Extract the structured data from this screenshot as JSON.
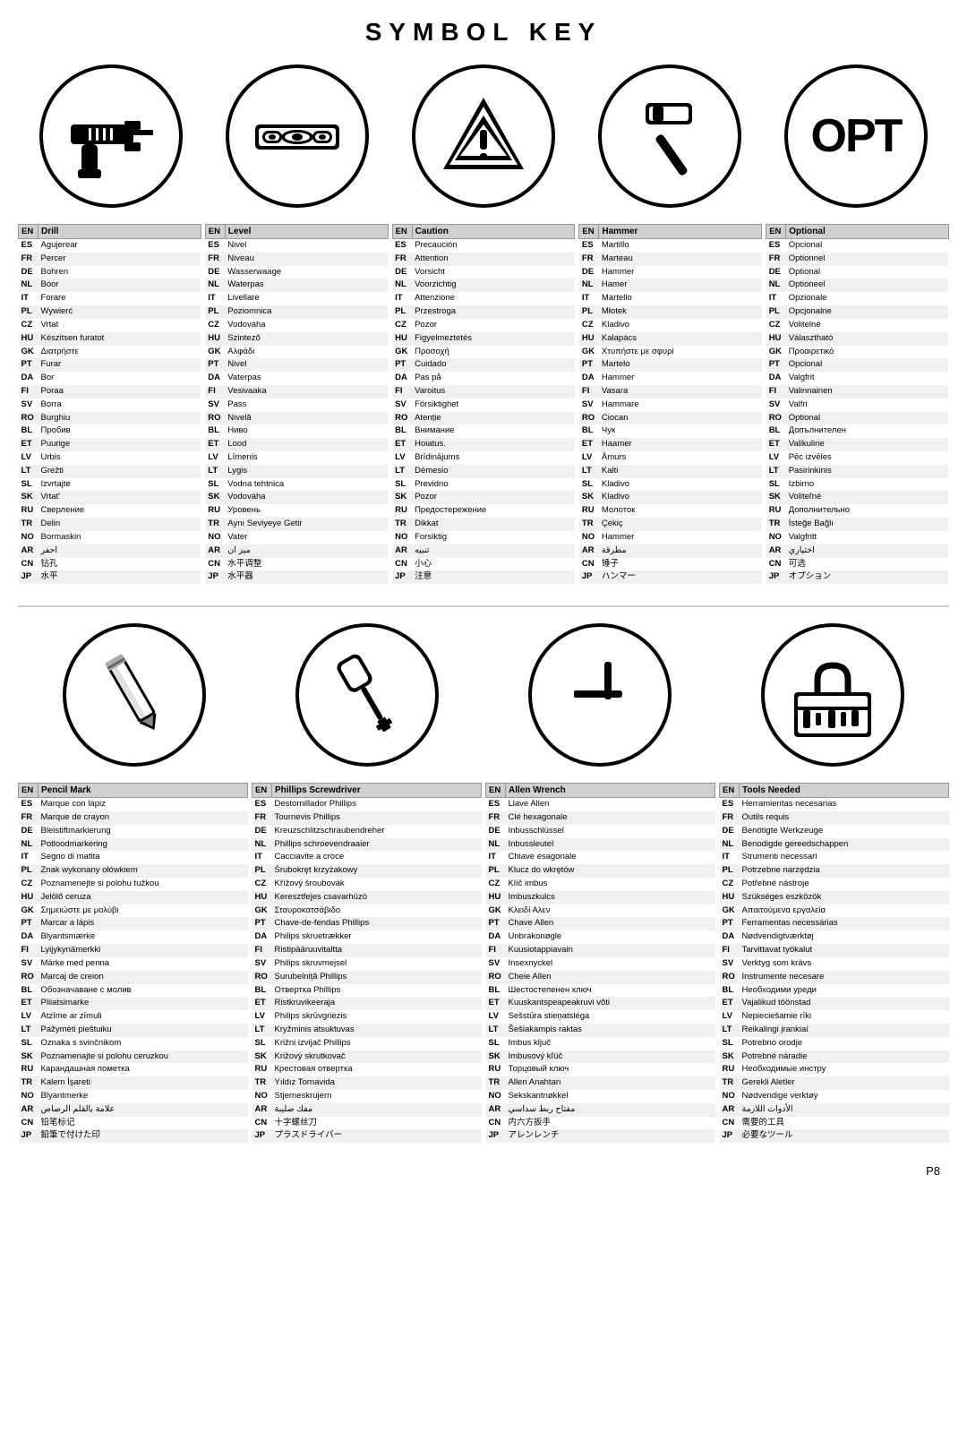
{
  "title": "SYMBOL KEY",
  "page_number": "P8",
  "icons_row1": [
    {
      "id": "drill",
      "type": "svg_drill"
    },
    {
      "id": "level",
      "type": "svg_level"
    },
    {
      "id": "caution",
      "type": "svg_caution"
    },
    {
      "id": "hammer",
      "type": "svg_hammer"
    },
    {
      "id": "optional",
      "type": "text_opt",
      "text": "OPT"
    }
  ],
  "icons_row2": [
    {
      "id": "pencil",
      "type": "svg_pencil"
    },
    {
      "id": "phillips",
      "type": "svg_phillips"
    },
    {
      "id": "allen",
      "type": "svg_allen"
    },
    {
      "id": "toolbox",
      "type": "svg_toolbox"
    }
  ],
  "tables": [
    {
      "id": "drill_table",
      "header_en": "EN",
      "header_term": "Drill",
      "rows": [
        [
          "ES",
          "Agujerear"
        ],
        [
          "FR",
          "Percer"
        ],
        [
          "DE",
          "Bohren"
        ],
        [
          "NL",
          "Boor"
        ],
        [
          "IT",
          "Forare"
        ],
        [
          "PL",
          "Wywierć"
        ],
        [
          "CZ",
          "Vrtat"
        ],
        [
          "HU",
          "Készitsen furatot"
        ],
        [
          "GK",
          "Διατρήστε"
        ],
        [
          "PT",
          "Furar"
        ],
        [
          "DA",
          "Bor"
        ],
        [
          "FI",
          "Poraa"
        ],
        [
          "SV",
          "Borra"
        ],
        [
          "RO",
          "Burghiu"
        ],
        [
          "BL",
          "Пробив"
        ],
        [
          "ET",
          "Puurige"
        ],
        [
          "LV",
          "Urbis"
        ],
        [
          "LT",
          "Grežti"
        ],
        [
          "SL",
          "Izvrtajte"
        ],
        [
          "SK",
          "Vrtat'"
        ],
        [
          "RU",
          "Сверление"
        ],
        [
          "TR",
          "Delin"
        ],
        [
          "NO",
          "Bormaskin"
        ],
        [
          "AR",
          "احفر"
        ],
        [
          "CN",
          "钻孔"
        ],
        [
          "JP",
          "水平"
        ]
      ]
    },
    {
      "id": "level_table",
      "header_en": "EN",
      "header_term": "Level",
      "rows": [
        [
          "ES",
          "Nivel"
        ],
        [
          "FR",
          "Niveau"
        ],
        [
          "DE",
          "Wasserwaage"
        ],
        [
          "NL",
          "Waterpas"
        ],
        [
          "IT",
          "Livellare"
        ],
        [
          "PL",
          "Poziomnica"
        ],
        [
          "CZ",
          "Vodováha"
        ],
        [
          "HU",
          "Szintező"
        ],
        [
          "GK",
          "Αλφάδι"
        ],
        [
          "PT",
          "Nivel"
        ],
        [
          "DA",
          "Vaterpas"
        ],
        [
          "FI",
          "Vesivaaka"
        ],
        [
          "SV",
          "Pass"
        ],
        [
          "RO",
          "Nivelă"
        ],
        [
          "BL",
          "Ниво"
        ],
        [
          "ET",
          "Lood"
        ],
        [
          "LV",
          "Līmenis"
        ],
        [
          "LT",
          "Lygis"
        ],
        [
          "SL",
          "Vodna tehtnica"
        ],
        [
          "SK",
          "Vodováha"
        ],
        [
          "RU",
          "Уровень"
        ],
        [
          "TR",
          "Aynı Seviyeye Getir"
        ],
        [
          "NO",
          "Vater"
        ],
        [
          "AR",
          "ميز ان"
        ],
        [
          "CN",
          "水平调整"
        ],
        [
          "JP",
          "水平器"
        ]
      ]
    },
    {
      "id": "caution_table",
      "header_en": "EN",
      "header_term": "Caution",
      "rows": [
        [
          "ES",
          "Precaución"
        ],
        [
          "FR",
          "Attention"
        ],
        [
          "DE",
          "Vorsicht"
        ],
        [
          "NL",
          "Voorzichtig"
        ],
        [
          "IT",
          "Attenzione"
        ],
        [
          "PL",
          "Przestroga"
        ],
        [
          "CZ",
          "Pozor"
        ],
        [
          "HU",
          "Figyelmeztetés"
        ],
        [
          "GK",
          "Προσοχή"
        ],
        [
          "PT",
          "Cuidado"
        ],
        [
          "DA",
          "Pas på"
        ],
        [
          "FI",
          "Varoitus"
        ],
        [
          "SV",
          "Försiktighet"
        ],
        [
          "RO",
          "Atenție"
        ],
        [
          "BL",
          "Внимание"
        ],
        [
          "ET",
          "Hoiatus."
        ],
        [
          "LV",
          "Brīdinājums"
        ],
        [
          "LT",
          "Dėmesio"
        ],
        [
          "SL",
          "Previdno"
        ],
        [
          "SK",
          "Pozor"
        ],
        [
          "RU",
          "Предостережение"
        ],
        [
          "TR",
          "Dikkat"
        ],
        [
          "NO",
          "Forsiktig"
        ],
        [
          "AR",
          "تنبيه"
        ],
        [
          "CN",
          "小心"
        ],
        [
          "JP",
          "注意"
        ]
      ]
    },
    {
      "id": "hammer_table",
      "header_en": "EN",
      "header_term": "Hammer",
      "rows": [
        [
          "ES",
          "Martillo"
        ],
        [
          "FR",
          "Marteau"
        ],
        [
          "DE",
          "Hammer"
        ],
        [
          "NL",
          "Hamer"
        ],
        [
          "IT",
          "Martello"
        ],
        [
          "PL",
          "Młotek"
        ],
        [
          "CZ",
          "Kladivo"
        ],
        [
          "HU",
          "Kalapács"
        ],
        [
          "GK",
          "Χτυπήστε με σφυρί"
        ],
        [
          "PT",
          "Martelo"
        ],
        [
          "DA",
          "Hammer"
        ],
        [
          "FI",
          "Vasara"
        ],
        [
          "SV",
          "Hammare"
        ],
        [
          "RO",
          "Ciocan"
        ],
        [
          "BL",
          "Чук"
        ],
        [
          "ET",
          "Haamer"
        ],
        [
          "LV",
          "Āmurs"
        ],
        [
          "LT",
          "Kalti"
        ],
        [
          "SL",
          "Kladivo"
        ],
        [
          "SK",
          "Kladivo"
        ],
        [
          "RU",
          "Молоток"
        ],
        [
          "TR",
          "Çekiç"
        ],
        [
          "NO",
          "Hammer"
        ],
        [
          "AR",
          "مطرقة"
        ],
        [
          "CN",
          "锤子"
        ],
        [
          "JP",
          "ハンマー"
        ]
      ]
    },
    {
      "id": "optional_table",
      "header_en": "EN",
      "header_term": "Optional",
      "rows": [
        [
          "ES",
          "Opcional"
        ],
        [
          "FR",
          "Optionnel"
        ],
        [
          "DE",
          "Optional"
        ],
        [
          "NL",
          "Optioneel"
        ],
        [
          "IT",
          "Opzionale"
        ],
        [
          "PL",
          "Opcjonalne"
        ],
        [
          "CZ",
          "Volitelné"
        ],
        [
          "HU",
          "Választható"
        ],
        [
          "GK",
          "Προαιρετικό"
        ],
        [
          "PT",
          "Opcional"
        ],
        [
          "DA",
          "Valgfrit"
        ],
        [
          "FI",
          "Valinnainen"
        ],
        [
          "SV",
          "Valfri"
        ],
        [
          "RO",
          "Optional"
        ],
        [
          "BL",
          "Допълнителен"
        ],
        [
          "ET",
          "Valikuline"
        ],
        [
          "LV",
          "Pēc izvēles"
        ],
        [
          "LT",
          "Pasirinkinis"
        ],
        [
          "SL",
          "Izbirno"
        ],
        [
          "SK",
          "Voliteľné"
        ],
        [
          "RU",
          "Дополнительно"
        ],
        [
          "TR",
          "İsteğe Bağlı"
        ],
        [
          "NO",
          "Valgfritt"
        ],
        [
          "AR",
          "اختياري"
        ],
        [
          "CN",
          "可选"
        ],
        [
          "JP",
          "オプション"
        ]
      ]
    }
  ],
  "tables2": [
    {
      "id": "pencil_table",
      "header_en": "EN",
      "header_term": "Pencil Mark",
      "rows": [
        [
          "ES",
          "Marque con lápiz"
        ],
        [
          "FR",
          "Marque de crayon"
        ],
        [
          "DE",
          "Bleistiftmarkierung"
        ],
        [
          "NL",
          "Potloodmarkering"
        ],
        [
          "IT",
          "Segno di matita"
        ],
        [
          "PL",
          "Znak wykonany ołówkiem"
        ],
        [
          "CZ",
          "Poznamenejte si polohu tužkou"
        ],
        [
          "HU",
          "Jelölő ceruza"
        ],
        [
          "GK",
          "Σημειώστε με μολύβι"
        ],
        [
          "PT",
          "Marcar a lápis"
        ],
        [
          "DA",
          "Blyantsmærke"
        ],
        [
          "FI",
          "Lyijykynämerkki"
        ],
        [
          "SV",
          "Märke med penna"
        ],
        [
          "RO",
          "Marcaj de creion"
        ],
        [
          "BL",
          "Обозначаване с молив"
        ],
        [
          "ET",
          "Pliiatsimarke"
        ],
        [
          "LV",
          "Atzīme ar zīmuli"
        ],
        [
          "LT",
          "Pažymėti pieštuiku"
        ],
        [
          "SL",
          "Oznaka s svinčnikom"
        ],
        [
          "SK",
          "Poznamenajte si polohu ceruzkou"
        ],
        [
          "RU",
          "Карандашная пометка"
        ],
        [
          "TR",
          "Kalem İşareti"
        ],
        [
          "NO",
          "Blyantmerke"
        ],
        [
          "AR",
          "علامة بالقلم الرصاص"
        ],
        [
          "CN",
          "铅笔标记"
        ],
        [
          "JP",
          "鉛筆で付けた印"
        ]
      ]
    },
    {
      "id": "phillips_table",
      "header_en": "EN",
      "header_term": "Phillips Screwdriver",
      "rows": [
        [
          "ES",
          "Destornillador Phillips"
        ],
        [
          "FR",
          "Tournevis Phillips"
        ],
        [
          "DE",
          "Kreuzschlitzschraubendreher"
        ],
        [
          "NL",
          "Phillips schroevendraaier"
        ],
        [
          "IT",
          "Cacciavite a croce"
        ],
        [
          "PL",
          "Śrubokręt krzyżakowy"
        ],
        [
          "CZ",
          "Křížový šroubovák"
        ],
        [
          "HU",
          "Keresztfejes csavarhúzó"
        ],
        [
          "GK",
          "Σταυροκατσάβιδο"
        ],
        [
          "PT",
          "Chave-de-fendas Phillips"
        ],
        [
          "DA",
          "Philips skruetrækker"
        ],
        [
          "FI",
          "Ristipääruuvitaltta"
        ],
        [
          "SV",
          "Philips skruvmejsel"
        ],
        [
          "RO",
          "Șurubelniță Phillips"
        ],
        [
          "BL",
          "Отвертка Phillips"
        ],
        [
          "ET",
          "Ristkruvikeeraja"
        ],
        [
          "LV",
          "Philips skrūvgriezis"
        ],
        [
          "LT",
          "Kryžminis atsuktuvas"
        ],
        [
          "SL",
          "Križni izvijač Phillips"
        ],
        [
          "SK",
          "Križový skrutkovač"
        ],
        [
          "RU",
          "Крестовая отвертка"
        ],
        [
          "TR",
          "Yıldız Tornavida"
        ],
        [
          "NO",
          "Stjerneskrujern"
        ],
        [
          "AR",
          "مفك صليبة"
        ],
        [
          "CN",
          "十字螺丝刀"
        ],
        [
          "JP",
          "プラスドライバー"
        ]
      ]
    },
    {
      "id": "allen_table",
      "header_en": "EN",
      "header_term": "Allen Wrench",
      "rows": [
        [
          "ES",
          "Llave Allen"
        ],
        [
          "FR",
          "Clé hexagonale"
        ],
        [
          "DE",
          "Inbusschlüssel"
        ],
        [
          "NL",
          "Inbussleutel"
        ],
        [
          "IT",
          "Chiave esagonale"
        ],
        [
          "PL",
          "Klucz do wkrętów"
        ],
        [
          "CZ",
          "Klíč imbus"
        ],
        [
          "HU",
          "Imbuszkulcs"
        ],
        [
          "GK",
          "Κλειδί Αλεν"
        ],
        [
          "PT",
          "Chave Allen"
        ],
        [
          "DA",
          "Unbrakonøgle"
        ],
        [
          "FI",
          "Kuusiotappiavain"
        ],
        [
          "SV",
          "Insexnyckel"
        ],
        [
          "RO",
          "Cheie Allen"
        ],
        [
          "BL",
          "Шестостепенен ключ"
        ],
        [
          "ET",
          "Kuuskantspeapeakruvi võti"
        ],
        [
          "LV",
          "Sešstūra stieņatsléga"
        ],
        [
          "LT",
          "Šešiakampis raktas"
        ],
        [
          "SL",
          "Imbus ključ"
        ],
        [
          "SK",
          "Imbusový kľúč"
        ],
        [
          "RU",
          "Торцовый ключ"
        ],
        [
          "TR",
          "Allen Anahtarı"
        ],
        [
          "NO",
          "Sekskantnøkkel"
        ],
        [
          "AR",
          "مفتاح ربط سداسي"
        ],
        [
          "CN",
          "内六方扳手"
        ],
        [
          "JP",
          "アレンレンチ"
        ]
      ]
    },
    {
      "id": "tools_table",
      "header_en": "EN",
      "header_term": "Tools Needed",
      "rows": [
        [
          "ES",
          "Herramientas necesarias"
        ],
        [
          "FR",
          "Outils requis"
        ],
        [
          "DE",
          "Benötigte Werkzeuge"
        ],
        [
          "NL",
          "Benodigde gereedschappen"
        ],
        [
          "IT",
          "Strumenti necessari"
        ],
        [
          "PL",
          "Potrzebne narzędzia"
        ],
        [
          "CZ",
          "Potřebné nástroje"
        ],
        [
          "HU",
          "Szükséges eszközök"
        ],
        [
          "GK",
          "Απαιτούμενα εργαλεία"
        ],
        [
          "PT",
          "Ferramentas necessárias"
        ],
        [
          "DA",
          "Nødvendigtværktøj"
        ],
        [
          "FI",
          "Tarvittavat työkalut"
        ],
        [
          "SV",
          "Verktyg som krävs"
        ],
        [
          "RO",
          "Instrumente necesare"
        ],
        [
          "BL",
          "Необходими уреди"
        ],
        [
          "ET",
          "Vajalikud töönstad"
        ],
        [
          "LV",
          "Nepieciešamie rīki"
        ],
        [
          "LT",
          "Reikalingi įrankiai"
        ],
        [
          "SL",
          "Potrebno orodje"
        ],
        [
          "SK",
          "Potrebné náradie"
        ],
        [
          "RU",
          "Необходимые инстру"
        ],
        [
          "TR",
          "Gerekli Aletler"
        ],
        [
          "NO",
          "Nødvendige verktøy"
        ],
        [
          "AR",
          "الأدوات اللازمة"
        ],
        [
          "CN",
          "需要的工具"
        ],
        [
          "JP",
          "必要なツール"
        ]
      ]
    }
  ]
}
